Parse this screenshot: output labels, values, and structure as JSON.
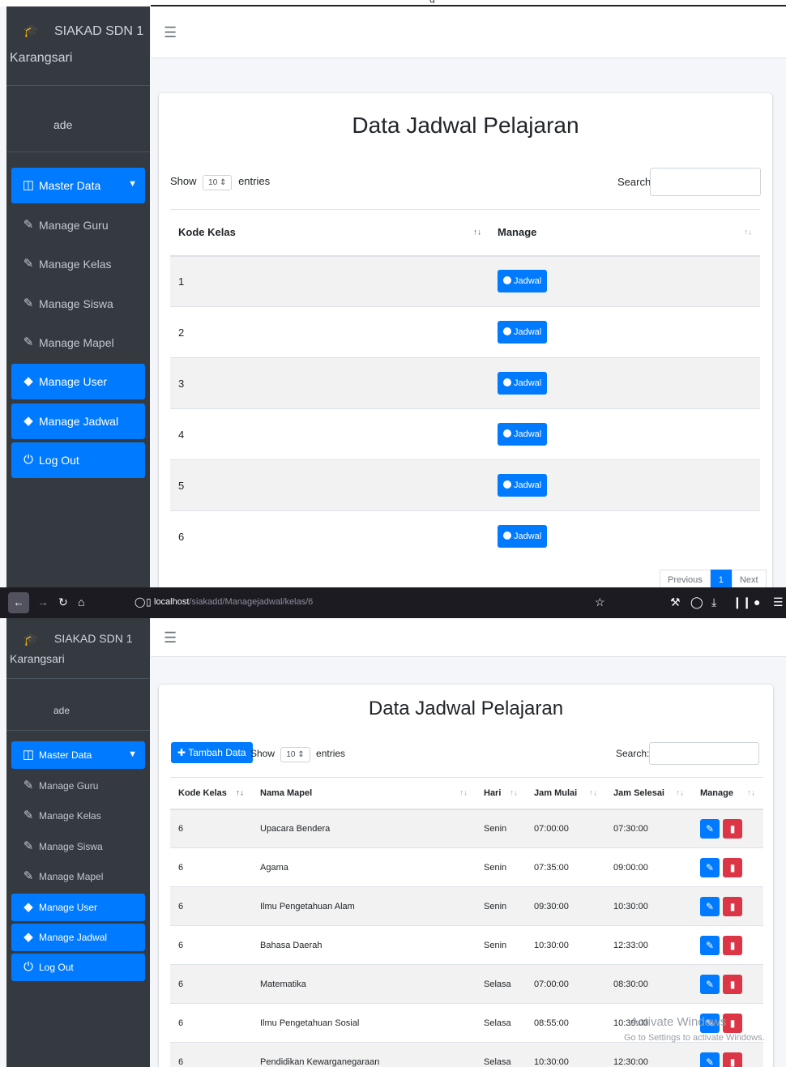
{
  "top": {
    "cut_text": "g"
  },
  "app": {
    "brand_line1": "SIAKAD SDN 1",
    "brand_line2": "Karangsari",
    "user": "ade",
    "menu": [
      {
        "label": "Master Data",
        "icon": "database-icon"
      },
      {
        "label": "Manage Guru",
        "icon": "edit-icon"
      },
      {
        "label": "Manage Kelas",
        "icon": "edit-icon"
      },
      {
        "label": "Manage Siswa",
        "icon": "edit-icon"
      },
      {
        "label": "Manage Mapel",
        "icon": "edit-icon"
      },
      {
        "label": "Manage User",
        "icon": "tag-icon"
      },
      {
        "label": "Manage Jadwal",
        "icon": "tag-icon"
      },
      {
        "label": "Log Out",
        "icon": "power-icon"
      }
    ]
  },
  "screen1": {
    "title": "Data Jadwal Pelajaran",
    "show_label": "Show",
    "entries_value": "10",
    "entries_label": "entries",
    "search_label": "Search:",
    "columns": [
      "Kode Kelas",
      "Manage"
    ],
    "button_label": "Jadwal",
    "rows": [
      "1",
      "2",
      "3",
      "4",
      "5",
      "6"
    ],
    "pager": {
      "prev": "Previous",
      "current": "1",
      "next": "Next"
    }
  },
  "browser": {
    "url_host": "localhost",
    "url_path": "/siakadd/Managejadwal/kelas/6"
  },
  "screen2": {
    "title": "Data Jadwal Pelajaran",
    "add_button": "Tambah Data",
    "show_label": "Show",
    "entries_value": "10",
    "entries_label": "entries",
    "search_label": "Search:",
    "columns": [
      "Kode Kelas",
      "Nama Mapel",
      "Hari",
      "Jam Mulai",
      "Jam Selesai",
      "Manage"
    ],
    "rows": [
      {
        "kelas": "6",
        "mapel": "Upacara Bendera",
        "hari": "Senin",
        "mulai": "07:00:00",
        "selesai": "07:30:00"
      },
      {
        "kelas": "6",
        "mapel": "Agama",
        "hari": "Senin",
        "mulai": "07:35:00",
        "selesai": "09:00:00"
      },
      {
        "kelas": "6",
        "mapel": "Ilmu Pengetahuan Alam",
        "hari": "Senin",
        "mulai": "09:30:00",
        "selesai": "10:30:00"
      },
      {
        "kelas": "6",
        "mapel": "Bahasa Daerah",
        "hari": "Senin",
        "mulai": "10:30:00",
        "selesai": "12:33:00"
      },
      {
        "kelas": "6",
        "mapel": "Matematika",
        "hari": "Selasa",
        "mulai": "07:00:00",
        "selesai": "08:30:00"
      },
      {
        "kelas": "6",
        "mapel": "Ilmu Pengetahuan Sosial",
        "hari": "Selasa",
        "mulai": "08:55:00",
        "selesai": "10:30:00"
      },
      {
        "kelas": "6",
        "mapel": "Pendidikan Kewarganegaraan",
        "hari": "Selasa",
        "mulai": "10:30:00",
        "selesai": "12:30:00"
      }
    ],
    "watermark_line1": "Activate Windows",
    "watermark_line2": "Go to Settings to activate Windows."
  },
  "colors": {
    "primary": "#007bff",
    "danger": "#dc3545",
    "sidebar": "#343a40"
  }
}
